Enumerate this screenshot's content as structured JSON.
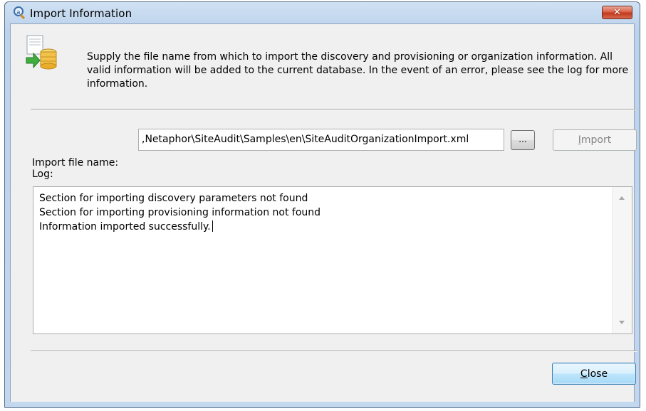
{
  "window": {
    "title": "Import Information",
    "close_glyph": "✕"
  },
  "header": {
    "icon": "database-import-icon",
    "description": "Supply the file name from which to import the discovery and provisioning or organization information.  All valid information will be added to the current database.  In the event of an error, please see the log for more information."
  },
  "import_row": {
    "label": "Import file name:",
    "file_value": ",Netaphor\\SiteAudit\\Samples\\en\\SiteAuditOrganizationImport.xml",
    "browse_label": "...",
    "import_label_prefix": "",
    "import_label_accel": "I",
    "import_label_rest": "mport",
    "import_enabled": false
  },
  "log": {
    "label": "Log:",
    "lines": [
      "Section for importing discovery parameters not found",
      "Section for importing provisioning information not found",
      "Information imported successfully."
    ]
  },
  "footer": {
    "close_label_accel": "C",
    "close_label_rest": "lose"
  },
  "colors": {
    "title_bar": "#c2d6ee",
    "client_bg": "#f0f0f0",
    "close_button_red": "#c2391d",
    "default_button_blue": "#3c7fb1"
  }
}
